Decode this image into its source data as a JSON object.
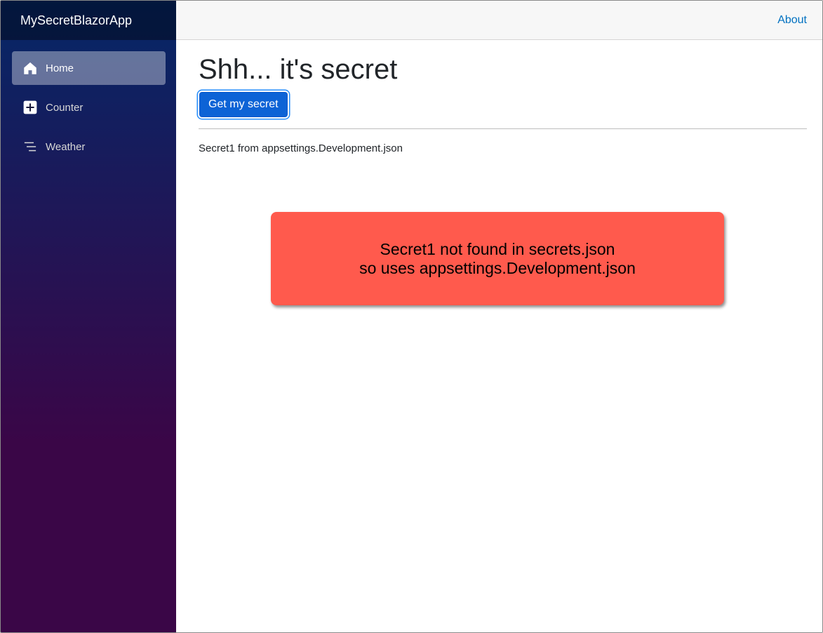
{
  "app": {
    "brand": "MySecretBlazorApp"
  },
  "sidebar": {
    "items": [
      {
        "label": "Home",
        "icon": "home-icon",
        "active": true
      },
      {
        "label": "Counter",
        "icon": "plus-square-icon",
        "active": false
      },
      {
        "label": "Weather",
        "icon": "list-nested-icon",
        "active": false
      }
    ]
  },
  "header": {
    "about_label": "About"
  },
  "main": {
    "title": "Shh... it's secret",
    "button_label": "Get my secret",
    "secret_text": "Secret1 from appsettings.Development.json"
  },
  "toast": {
    "line1": "Secret1 not found in secrets.json",
    "line2": "so uses appsettings.Development.json"
  },
  "colors": {
    "sidebar_top": "#052767",
    "sidebar_bottom": "#3a0647",
    "primary_button": "#0d63d6",
    "link": "#0071c1",
    "toast_background": "#ff5a4d"
  }
}
